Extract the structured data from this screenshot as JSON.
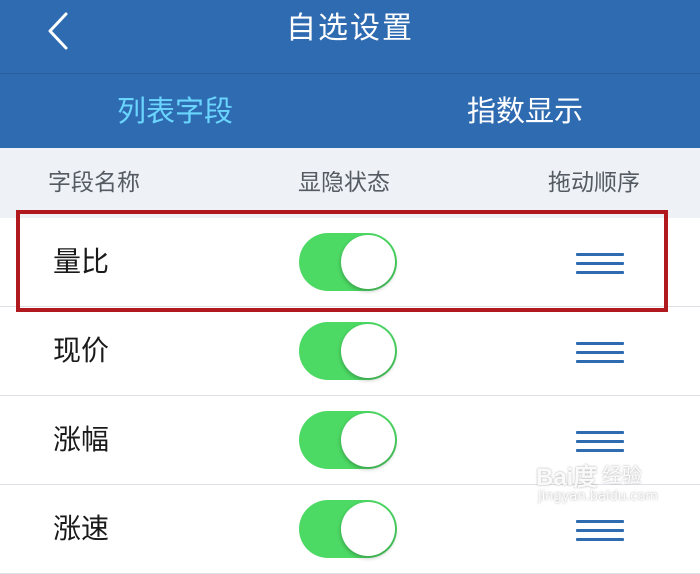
{
  "header": {
    "title": "自选设置",
    "back_icon": "chevron-left-icon"
  },
  "tabs": [
    {
      "label": "列表字段",
      "active": true
    },
    {
      "label": "指数显示",
      "active": false
    }
  ],
  "columns": {
    "name": "字段名称",
    "visibility": "显隐状态",
    "order": "拖动顺序"
  },
  "rows": [
    {
      "name": "量比",
      "enabled": true
    },
    {
      "name": "现价",
      "enabled": true
    },
    {
      "name": "涨幅",
      "enabled": true
    },
    {
      "name": "涨速",
      "enabled": true
    }
  ],
  "colors": {
    "header_bg": "#2f6bb1",
    "active_tab": "#6ad6ff",
    "toggle_on": "#4cd964",
    "drag_handle": "#2f6bb1",
    "highlight_border": "#b01a1f"
  },
  "watermark": {
    "logo": "Bai度",
    "brand": "经验",
    "url": "jingyan.baidu.com"
  }
}
